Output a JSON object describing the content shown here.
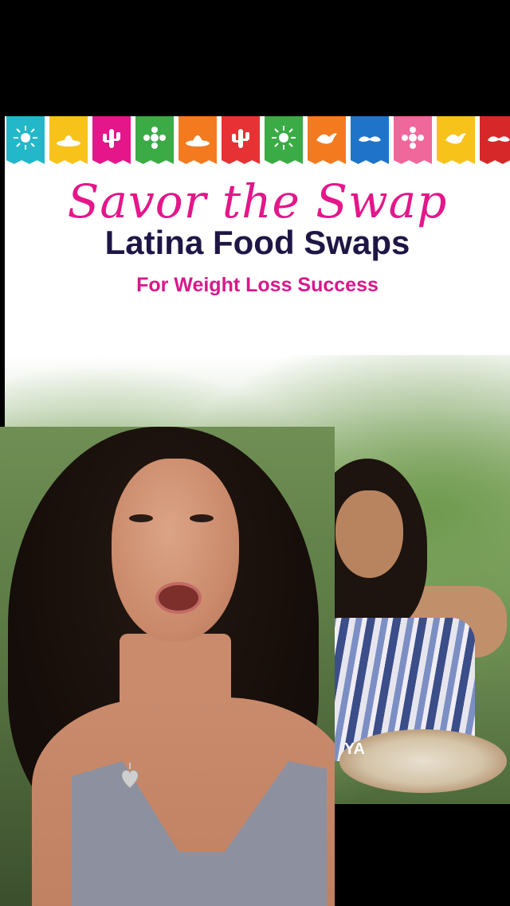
{
  "banner": {
    "flags": [
      {
        "color": "#22b8c9",
        "icon": "sun-icon"
      },
      {
        "color": "#f7c21a",
        "icon": "sombrero-icon"
      },
      {
        "color": "#e4168a",
        "icon": "cactus-icon"
      },
      {
        "color": "#3aab45",
        "icon": "flower-icon"
      },
      {
        "color": "#f47a20",
        "icon": "sombrero-icon"
      },
      {
        "color": "#e63234",
        "icon": "cactus-icon"
      },
      {
        "color": "#3aab45",
        "icon": "sun-icon"
      },
      {
        "color": "#f47a20",
        "icon": "bird-icon"
      },
      {
        "color": "#1f74c9",
        "icon": "mustache-icon"
      },
      {
        "color": "#f0679b",
        "icon": "flower-icon"
      },
      {
        "color": "#f7c21a",
        "icon": "bird-icon"
      },
      {
        "color": "#d62828",
        "icon": "mustache-icon"
      }
    ]
  },
  "headline": {
    "script": "Savor the Swap",
    "main": "Latina Food Swaps",
    "sub": "For Weight Loss Success"
  },
  "photo": {
    "caption_fragment": "YA"
  },
  "colors": {
    "script_pink": "#e4168a",
    "main_navy": "#1f1645",
    "sub_pink": "#d8188a"
  }
}
